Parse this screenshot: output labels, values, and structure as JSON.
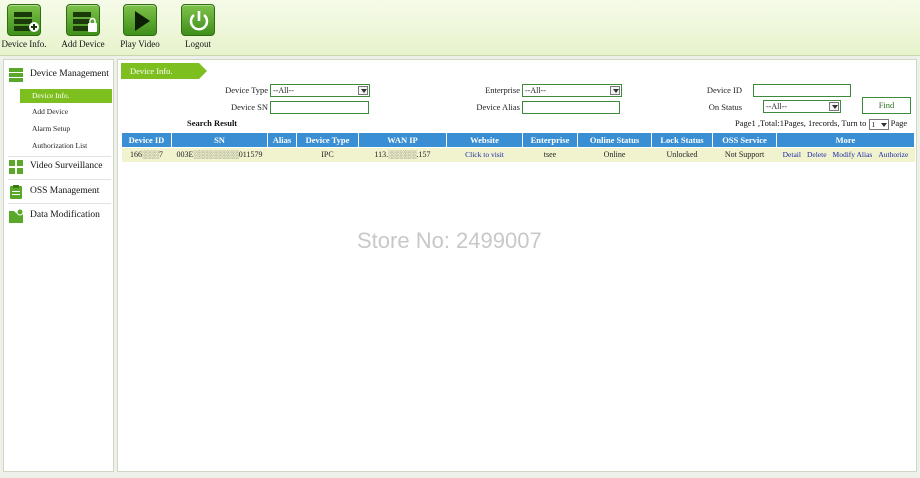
{
  "toolbar": [
    {
      "label": "Device Info.",
      "icon": "device-info-icon"
    },
    {
      "label": "Add Device",
      "icon": "add-device-icon"
    },
    {
      "label": "Play Video",
      "icon": "play-icon"
    },
    {
      "label": "Logout",
      "icon": "power-icon"
    }
  ],
  "sidebar": {
    "device_management": "Device Management",
    "items": [
      "Device Info.",
      "Add Device",
      "Alarm Setup",
      "Authorization List"
    ],
    "video_surveillance": "Video Surveillance",
    "oss_management": "OSS Management",
    "data_modification": "Data Modification"
  },
  "breadcrumb": "Device Info.",
  "filters": {
    "device_type_label": "Device Type",
    "device_type_value": "--All--",
    "device_sn_label": "Device SN",
    "enterprise_label": "Enterprise",
    "enterprise_value": "--All--",
    "device_alias_label": "Device Alias",
    "device_id_label": "Device ID",
    "on_status_label": "On Status",
    "on_status_value": "--All--",
    "find_label": "Find"
  },
  "search_result": "Search Result",
  "pager": {
    "text": "Page1 ,Total:1Pages, 1records, Turn to",
    "page_value": "1",
    "suffix": "Page"
  },
  "table": {
    "headers": [
      "Device ID",
      "SN",
      "Alias",
      "Device Type",
      "WAN IP",
      "Website",
      "Enterprise",
      "Online Status",
      "Lock Status",
      "OSS Service",
      "More"
    ],
    "row": {
      "device_id": "166░░░7",
      "sn": "003E░░░░░░░░011579",
      "alias": "",
      "device_type": "IPC",
      "wan_ip": "113.░░░░░.157",
      "website": "Click to visit",
      "enterprise": "tsee",
      "online_status": "Online",
      "lock_status": "Unlocked",
      "oss_service": "Not Support",
      "actions": [
        "Detail",
        "Delete",
        "Modify Alias",
        "Authorize"
      ]
    }
  },
  "watermark": "Store No: 2499007",
  "colors": {
    "accent_green": "#7cbf1f",
    "header_blue": "#3a8fd4",
    "row_bg": "#f1f3cf",
    "link": "#1a2aa8"
  }
}
